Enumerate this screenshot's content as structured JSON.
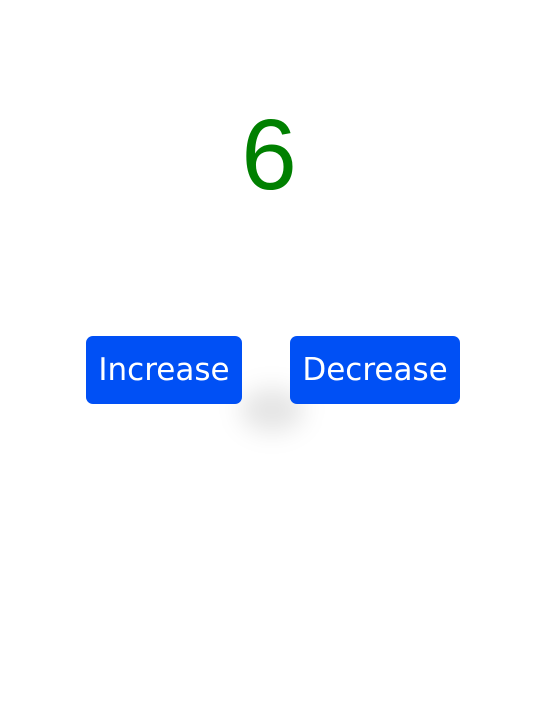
{
  "counter": {
    "value": "6",
    "color": "#008000"
  },
  "buttons": {
    "increase_label": "Increase",
    "decrease_label": "Decrease",
    "background_color": "#0050f5",
    "text_color": "#ffffff"
  }
}
